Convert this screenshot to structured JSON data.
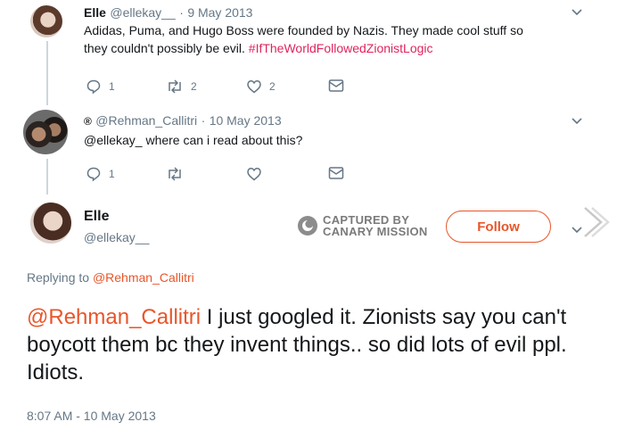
{
  "tweet1": {
    "name": "Elle",
    "handle": "@ellekay__",
    "dot": "·",
    "date": "9 May 2013",
    "text_line1": "Adidas, Puma, and Hugo Boss were founded by Nazis. They made cool stuff so",
    "text_line2": "they couldn't possibly be evil.",
    "hashtag": "#IfTheWorldFollowedZionistLogic",
    "reply_count": "1",
    "retweet_count": "2",
    "like_count": "2"
  },
  "tweet2": {
    "badge": "®",
    "handle": "@Rehman_Callitri",
    "dot": "·",
    "date": "10 May 2013",
    "text": "@ellekay_ where can i read about this?",
    "reply_count": "1"
  },
  "main_tweet": {
    "name": "Elle",
    "handle": "@ellekay__",
    "follow_label": "Follow",
    "replying_prefix": "Replying to",
    "replying_to": "@Rehman_Callitri",
    "mention": "@Rehman_Callitri",
    "text": "I just googled it. Zionists say you can't boycott them bc they invent things.. so did lots of evil ppl. Idiots.",
    "timestamp": "8:07 AM - 10 May 2013"
  },
  "watermark": {
    "line1": "CAPTURED BY",
    "line2": "CANARY MISSION"
  },
  "colors": {
    "accent": "#e8562a",
    "hashtag": "#e0245e",
    "muted": "#657786"
  }
}
